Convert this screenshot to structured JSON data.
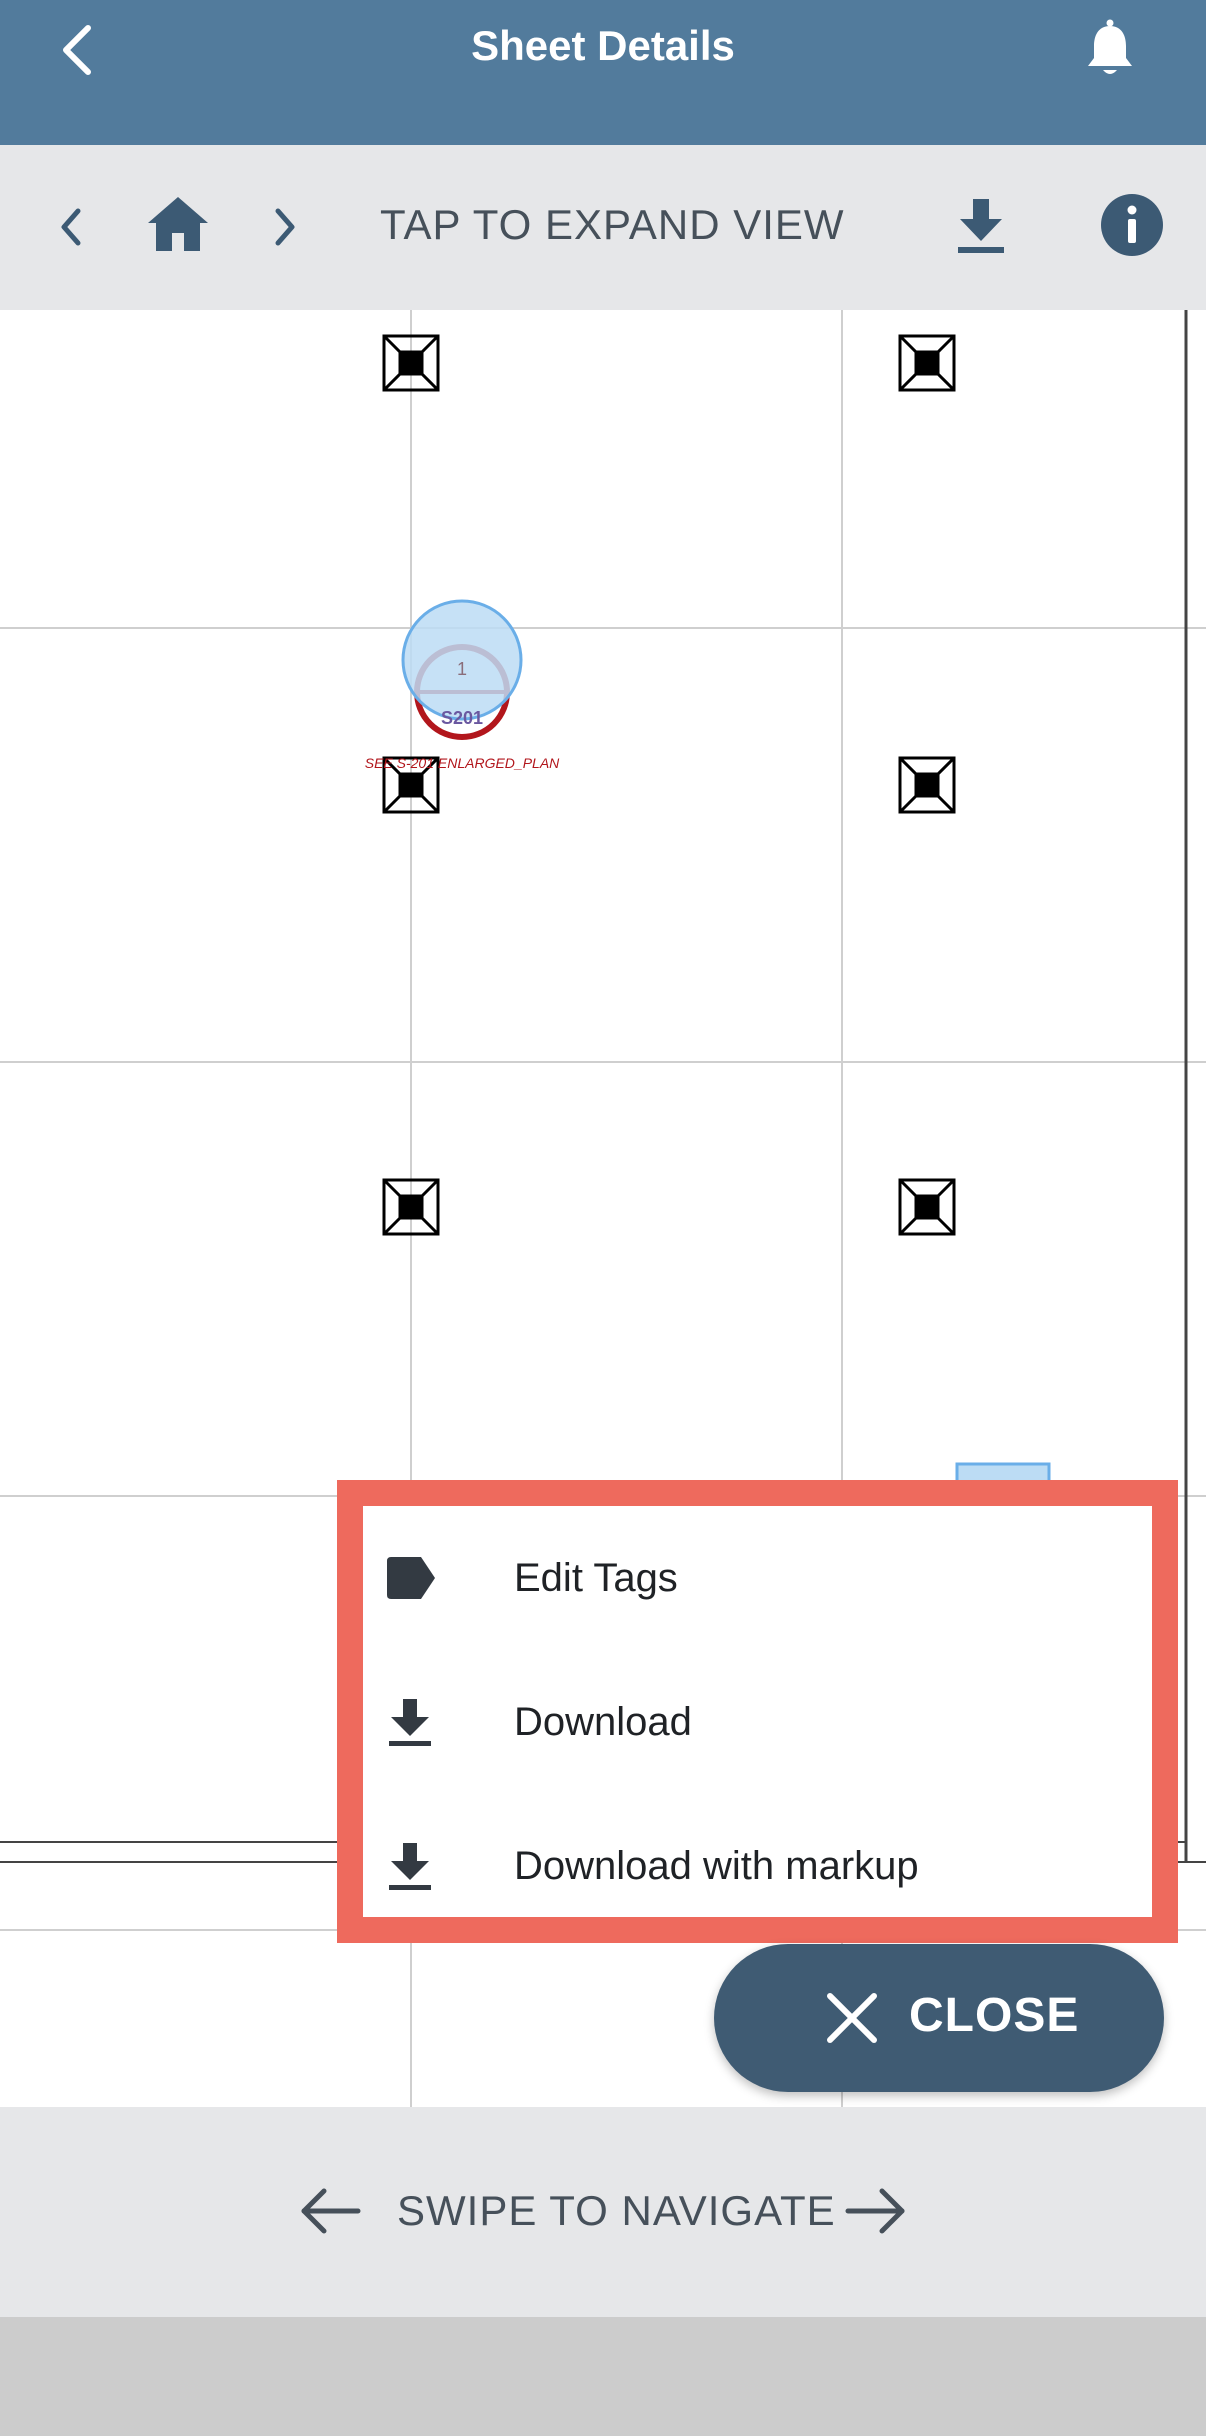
{
  "header": {
    "title": "Sheet Details",
    "back_icon": "chevron-left-icon",
    "notification_icon": "bell-icon"
  },
  "toolbar": {
    "label": "TAP TO EXPAND VIEW",
    "icons": [
      "chevron-left-icon",
      "home-icon",
      "chevron-right-icon",
      "download-icon",
      "info-icon"
    ]
  },
  "sheet": {
    "callout_number": "1",
    "callout_sheet": "S201",
    "callout_note": "SEE S-201 ENLARGED_PLAN"
  },
  "menu": {
    "items": [
      {
        "label": "Edit Tags",
        "icon": "tag-icon"
      },
      {
        "label": "Download",
        "icon": "download-icon"
      },
      {
        "label": "Download with markup",
        "icon": "download-icon"
      }
    ],
    "highlight_color": "#ee6a5d"
  },
  "close_button": {
    "label": "CLOSE",
    "icon": "close-icon"
  },
  "footer": {
    "label": "SWIPE TO NAVIGATE",
    "icons": [
      "arrow-left-icon",
      "arrow-right-icon"
    ]
  },
  "colors": {
    "header": "#527b9c",
    "toolbar": "#e6e7e9",
    "primary_dark": "#3f5b73",
    "callout_red": "#b2161c",
    "callout_blue": "#6aaee8"
  }
}
